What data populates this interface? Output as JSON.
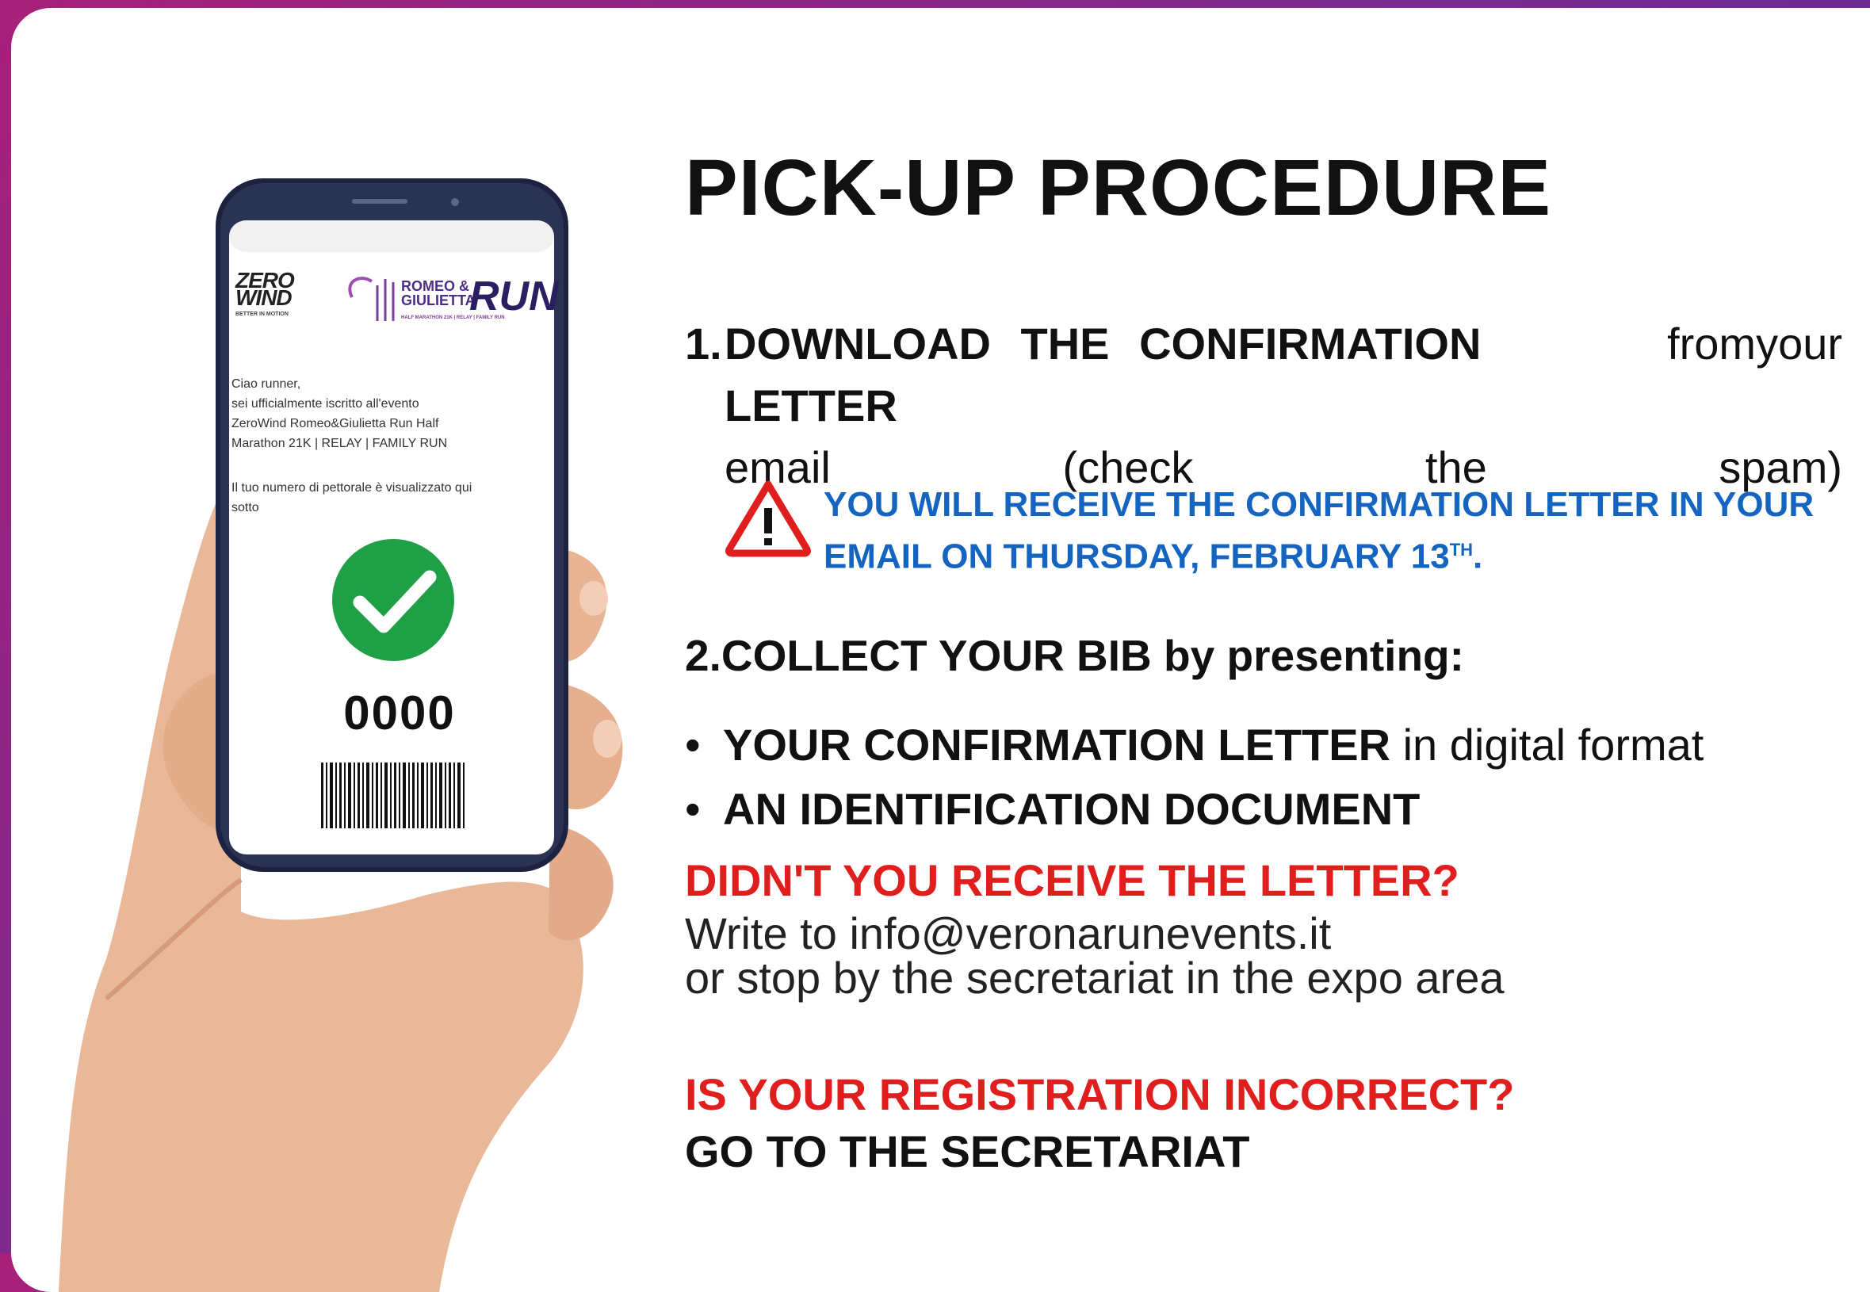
{
  "title": "PICK-UP PROCEDURE",
  "step1": {
    "number": "1.",
    "bold": "DOWNLOAD THE CONFIRMATION LETTER",
    "rest_words": [
      "from",
      "your"
    ],
    "line2_words": [
      "email",
      "(check",
      "the",
      "spam)"
    ]
  },
  "warning": {
    "line1": "YOU WILL RECEIVE THE CONFIRMATION LETTER IN YOUR",
    "line2": "EMAIL ON THURSDAY, FEBRUARY 13",
    "suffix": "TH",
    "end": "."
  },
  "step2": {
    "label": "2.COLLECT YOUR BIB by presenting:"
  },
  "bullets": [
    {
      "bold": "YOUR CONFIRMATION LETTER",
      "rest": " in digital format"
    },
    {
      "bold": "AN IDENTIFICATION DOCUMENT",
      "rest": ""
    }
  ],
  "question1": "DIDN'T YOU RECEIVE THE LETTER?",
  "write_line1": "Write to info@veronarunevents.it",
  "write_line2": "or stop by the secretariat in the expo area",
  "question2": "IS YOUR REGISTRATION INCORRECT?",
  "goto": "GO TO THE SECRETARIAT",
  "phone": {
    "logo_zero": "ZERO",
    "logo_wind": "WIND",
    "logo_zero_tagline": "BETTER IN MOTION",
    "logo_romeo": "ROMEO &",
    "logo_giulietta": "GIULIETTA",
    "logo_run": "RUN",
    "logo_tagline": "HALF MARATHON 21K | RELAY | FAMILY RUN",
    "greeting_lines": [
      "Ciao runner,",
      "sei ufficialmente iscritto all'evento",
      "ZeroWind Romeo&Giulietta Run Half",
      "Marathon 21K | RELAY | FAMILY RUN"
    ],
    "bib_info_lines": [
      "Il tuo numero di pettorale è visualizzato qui",
      "sotto"
    ],
    "bib_number": "0000"
  },
  "colors": {
    "accent_red": "#e01e1e",
    "accent_blue": "#1565c0",
    "check_green": "#1fa046",
    "frame_gradient_start": "#a8207a",
    "frame_gradient_end": "#4b2aa0"
  },
  "icons": {
    "warning": "warning-triangle-icon",
    "check": "check-circle-icon",
    "barcode": "barcode-icon"
  }
}
